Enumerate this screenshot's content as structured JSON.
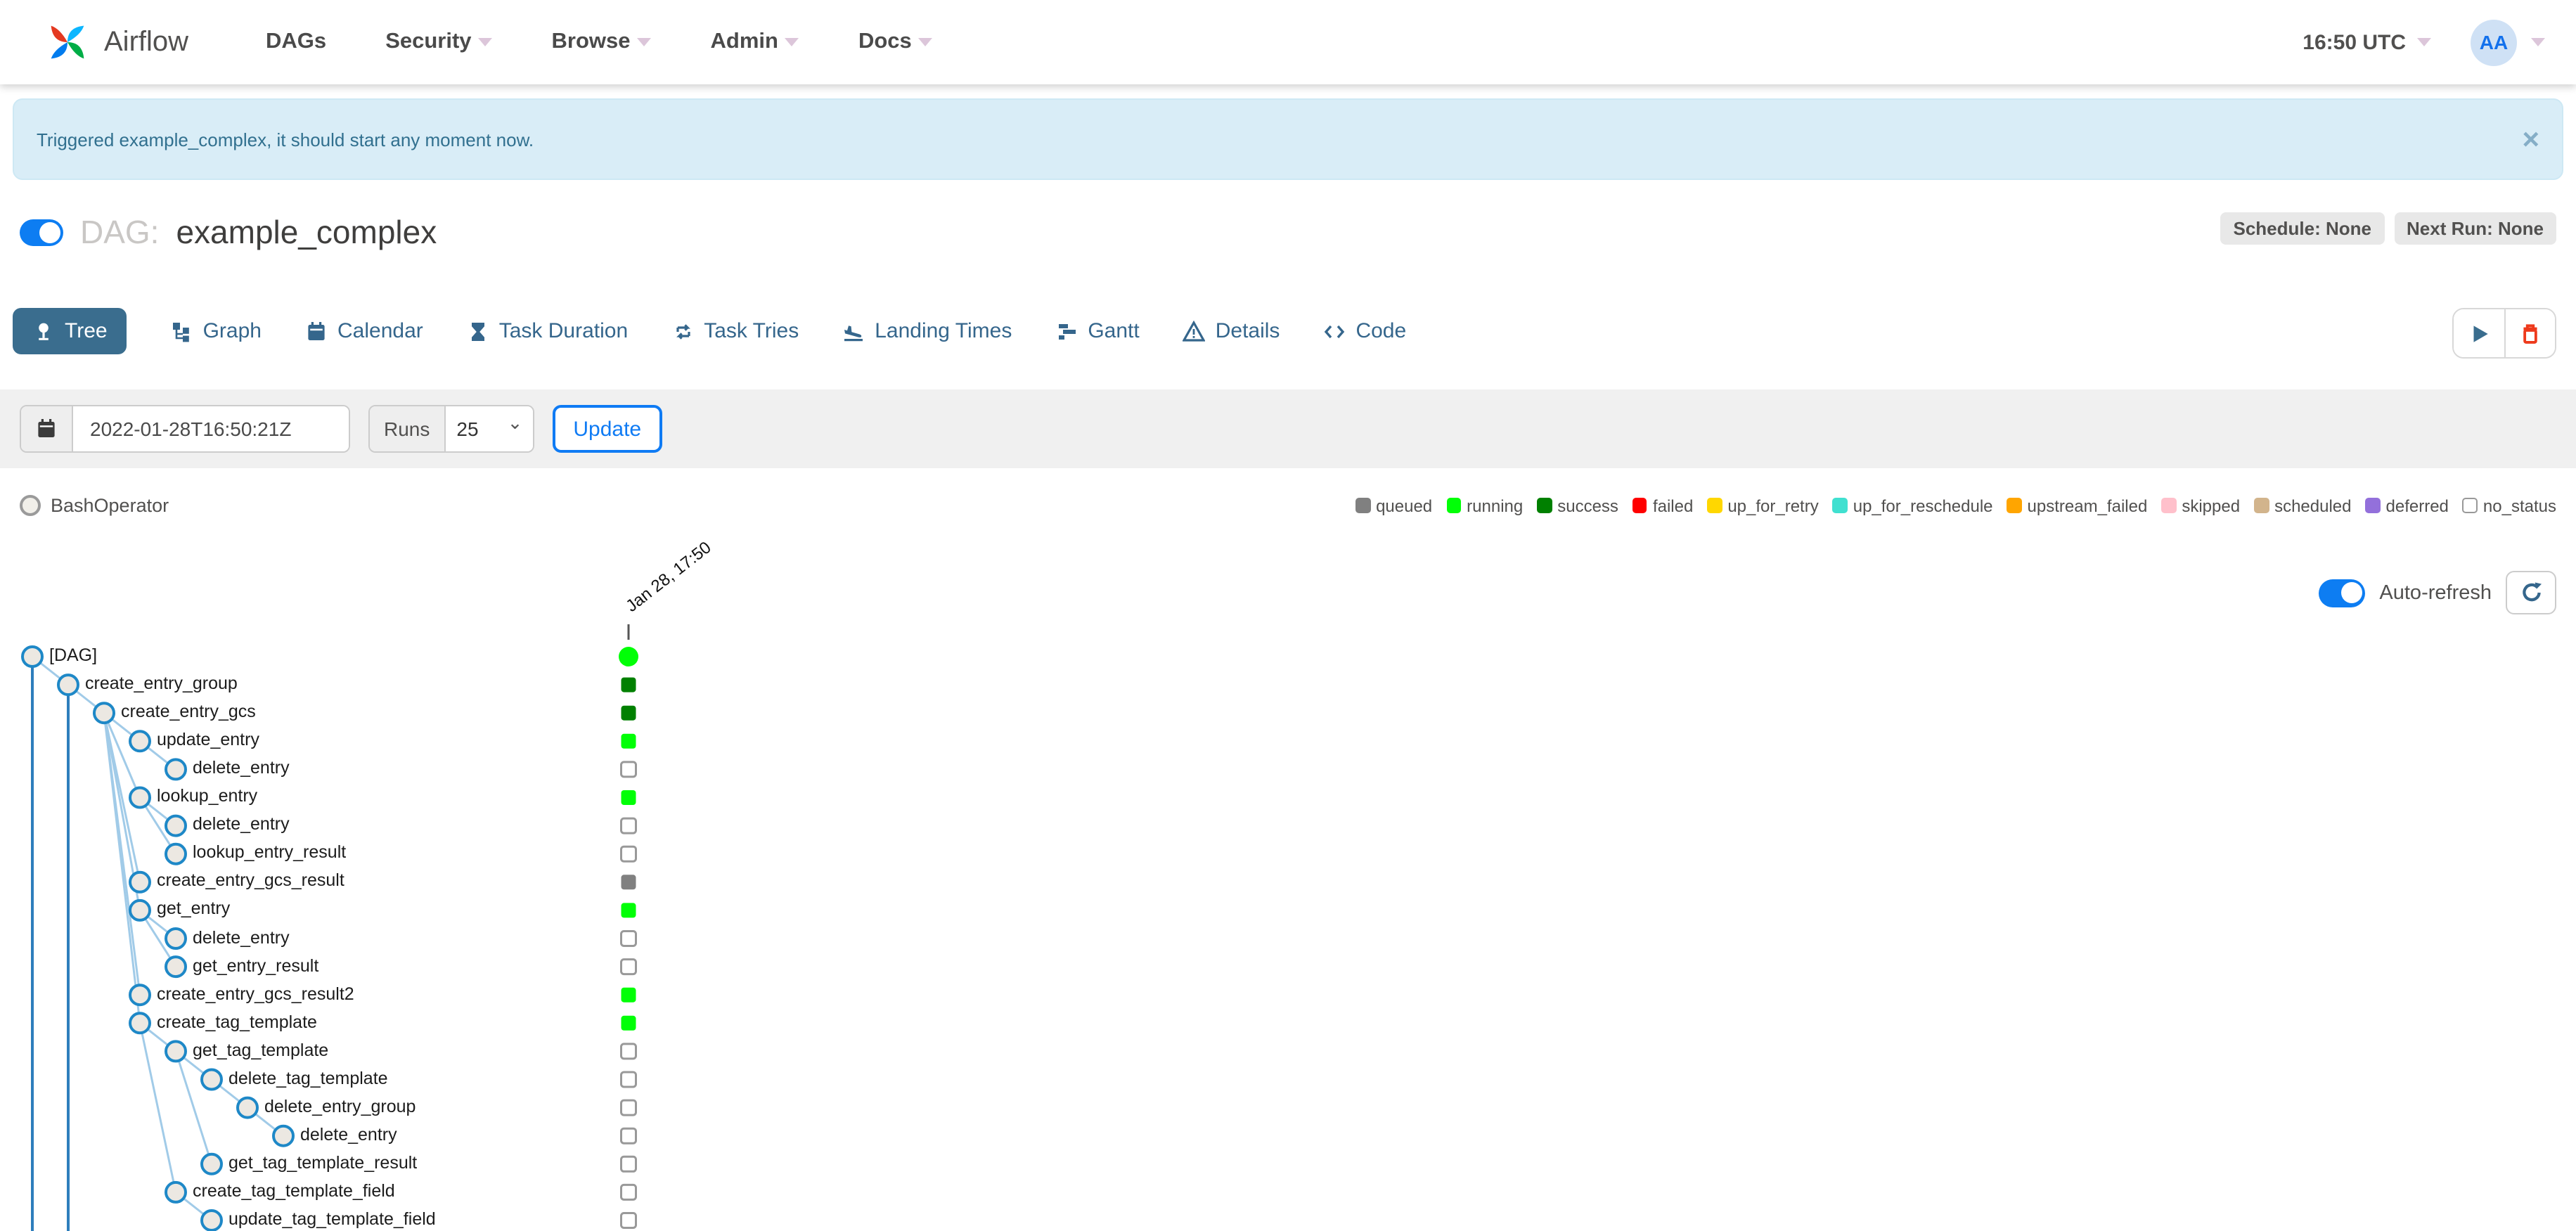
{
  "navbar": {
    "brand": "Airflow",
    "items": [
      {
        "label": "DAGs",
        "caret": false
      },
      {
        "label": "Security",
        "caret": true
      },
      {
        "label": "Browse",
        "caret": true
      },
      {
        "label": "Admin",
        "caret": true
      },
      {
        "label": "Docs",
        "caret": true
      }
    ],
    "clock": "16:50 UTC",
    "avatar_initials": "AA"
  },
  "alert": {
    "message": "Triggered example_complex, it should start any moment now.",
    "close_glyph": "×"
  },
  "dag_header": {
    "prefix": "DAG:",
    "title": "example_complex",
    "badges": [
      "Schedule: None",
      "Next Run: None"
    ]
  },
  "tabs": [
    {
      "label": "Tree",
      "icon": "tree-icon",
      "active": true
    },
    {
      "label": "Graph",
      "icon": "graph-icon",
      "active": false
    },
    {
      "label": "Calendar",
      "icon": "calendar-icon",
      "active": false
    },
    {
      "label": "Task Duration",
      "icon": "hourglass-icon",
      "active": false
    },
    {
      "label": "Task Tries",
      "icon": "repeat-icon",
      "active": false
    },
    {
      "label": "Landing Times",
      "icon": "plane-landing-icon",
      "active": false
    },
    {
      "label": "Gantt",
      "icon": "gantt-icon",
      "active": false
    },
    {
      "label": "Details",
      "icon": "details-icon",
      "active": false
    },
    {
      "label": "Code",
      "icon": "code-icon",
      "active": false
    }
  ],
  "filter": {
    "date_value": "2022-01-28T16:50:21Z",
    "runs_label": "Runs",
    "runs_value": "25",
    "update_label": "Update"
  },
  "legend": {
    "operator": "BashOperator",
    "states": [
      {
        "label": "queued",
        "color": "#808080",
        "border": "none"
      },
      {
        "label": "running",
        "color": "#01ff07",
        "border": "none"
      },
      {
        "label": "success",
        "color": "#008000",
        "border": "none"
      },
      {
        "label": "failed",
        "color": "#ff0000",
        "border": "none"
      },
      {
        "label": "up_for_retry",
        "color": "#ffd700",
        "border": "none"
      },
      {
        "label": "up_for_reschedule",
        "color": "#40e0d0",
        "border": "none"
      },
      {
        "label": "upstream_failed",
        "color": "#ffa500",
        "border": "none"
      },
      {
        "label": "skipped",
        "color": "#ffc0cb",
        "border": "none"
      },
      {
        "label": "scheduled",
        "color": "#d2b48c",
        "border": "none"
      },
      {
        "label": "deferred",
        "color": "#9370db",
        "border": "none"
      },
      {
        "label": "no_status",
        "color": "#ffffff",
        "border": "#999999"
      }
    ]
  },
  "toolbar": {
    "auto_refresh_label": "Auto-refresh"
  },
  "tree": {
    "run_column_label": "Jan 28, 17:50",
    "state_colors": {
      "queued": "#808080",
      "running": "#01ff07",
      "success": "#008000",
      "failed": "#ff0000",
      "up_for_retry": "#ffd700",
      "up_for_reschedule": "#40e0d0",
      "upstream_failed": "#ffa500",
      "skipped": "#ffc0cb",
      "scheduled": "#d2b48c",
      "deferred": "#9370db",
      "no_status": "#ffffff"
    },
    "rows": [
      {
        "name": "[DAG]",
        "level": 0,
        "status": "running",
        "shape": "circle"
      },
      {
        "name": "create_entry_group",
        "level": 1,
        "status": "success",
        "shape": "square"
      },
      {
        "name": "create_entry_gcs",
        "level": 2,
        "status": "success",
        "shape": "square"
      },
      {
        "name": "update_entry",
        "level": 3,
        "status": "running",
        "shape": "square"
      },
      {
        "name": "delete_entry",
        "level": 4,
        "status": "no_status",
        "shape": "square"
      },
      {
        "name": "lookup_entry",
        "level": 3,
        "status": "running",
        "shape": "square"
      },
      {
        "name": "delete_entry",
        "level": 4,
        "status": "no_status",
        "shape": "square"
      },
      {
        "name": "lookup_entry_result",
        "level": 4,
        "status": "no_status",
        "shape": "square"
      },
      {
        "name": "create_entry_gcs_result",
        "level": 3,
        "status": "queued",
        "shape": "square"
      },
      {
        "name": "get_entry",
        "level": 3,
        "status": "running",
        "shape": "square"
      },
      {
        "name": "delete_entry",
        "level": 4,
        "status": "no_status",
        "shape": "square"
      },
      {
        "name": "get_entry_result",
        "level": 4,
        "status": "no_status",
        "shape": "square"
      },
      {
        "name": "create_entry_gcs_result2",
        "level": 3,
        "status": "running",
        "shape": "square"
      },
      {
        "name": "create_tag_template",
        "level": 3,
        "status": "running",
        "shape": "square"
      },
      {
        "name": "get_tag_template",
        "level": 4,
        "status": "no_status",
        "shape": "square"
      },
      {
        "name": "delete_tag_template",
        "level": 5,
        "status": "no_status",
        "shape": "square"
      },
      {
        "name": "delete_entry_group",
        "level": 6,
        "status": "no_status",
        "shape": "square"
      },
      {
        "name": "delete_entry",
        "level": 7,
        "status": "no_status",
        "shape": "square"
      },
      {
        "name": "get_tag_template_result",
        "level": 5,
        "status": "no_status",
        "shape": "square"
      },
      {
        "name": "create_tag_template_field",
        "level": 4,
        "status": "no_status",
        "shape": "square"
      },
      {
        "name": "update_tag_template_field",
        "level": 5,
        "status": "no_status",
        "shape": "square"
      }
    ]
  }
}
